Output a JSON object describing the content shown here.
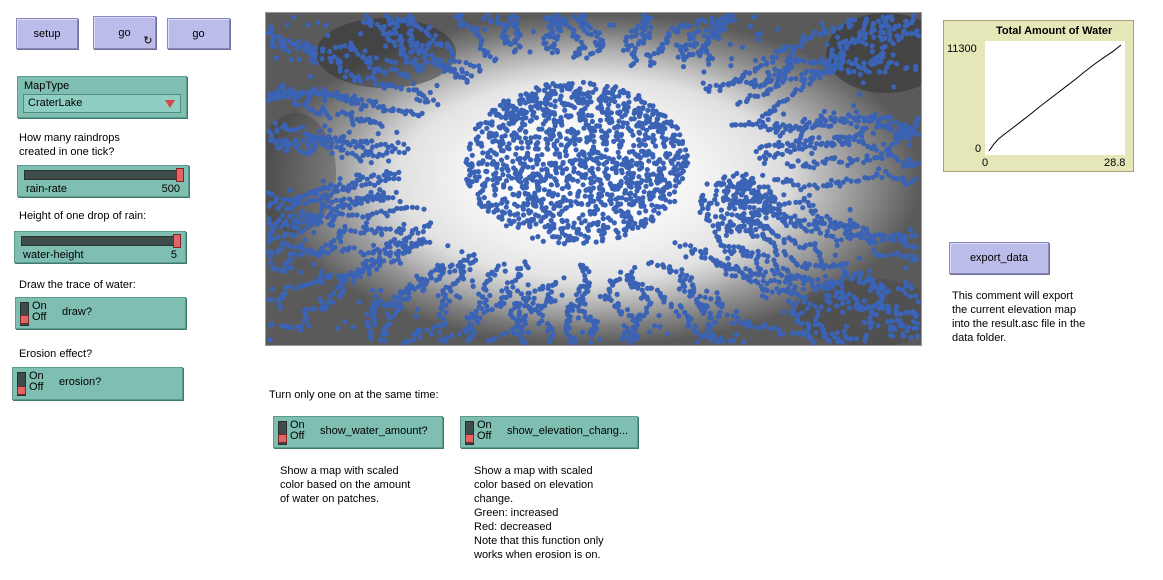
{
  "buttons": {
    "setup": "setup",
    "go_forever": "go",
    "go_once": "go",
    "export_data": "export_data",
    "forever_icon": "refresh-cycle-icon"
  },
  "chooser": {
    "label": "MapType",
    "value": "CraterLake"
  },
  "labels": {
    "raindrops": "How many raindrops\ncreated in one tick?",
    "drop_height": "Height of one drop of rain:",
    "trace": "Draw the trace of water:",
    "erosion": "Erosion effect?",
    "turn_one": "Turn only one on at the same time:"
  },
  "sliders": {
    "rain_rate": {
      "name": "rain-rate",
      "value": "500",
      "fraction": 1.0
    },
    "water_height": {
      "name": "water-height",
      "value": "5",
      "fraction": 1.0
    }
  },
  "switches": {
    "on_label": "On",
    "off_label": "Off",
    "draw": "draw?",
    "erosion": "erosion?",
    "show_water": "show_water_amount?",
    "show_elevation": "show_elevation_chang..."
  },
  "notes": {
    "water_note": "Show a map with scaled\ncolor based on the amount\nof water on patches.",
    "elevation_note": "Show a map with scaled\ncolor based on elevation\nchange.\nGreen: increased\nRed: decreased\nNote that this function only\nworks when erosion is on.",
    "export_note": "This comment will export\nthe current elevation map\ninto the result.asc file in the\ndata folder."
  },
  "colors": {
    "water_dot": "#3b63b5",
    "button": "#bcbcea",
    "widget": "#7fbfb2",
    "plot_bg": "#e6e7b9"
  },
  "chart_data": {
    "type": "line",
    "title": "Total Amount of Water",
    "xlabel": "",
    "ylabel": "",
    "xlim": [
      0,
      28.8
    ],
    "ylim": [
      0,
      11300
    ],
    "x_tick_labels": [
      "0",
      "28.8"
    ],
    "y_tick_labels": [
      "0",
      "11300"
    ],
    "series": [
      {
        "x": [
          0,
          1,
          2,
          3,
          5,
          7,
          9,
          11,
          13,
          15,
          17,
          19,
          21,
          23,
          25,
          27,
          28.8
        ],
        "values": [
          0,
          700,
          1250,
          1650,
          2400,
          3150,
          3900,
          4700,
          5450,
          6200,
          6950,
          7700,
          8500,
          9250,
          9950,
          10600,
          11300
        ]
      }
    ]
  }
}
